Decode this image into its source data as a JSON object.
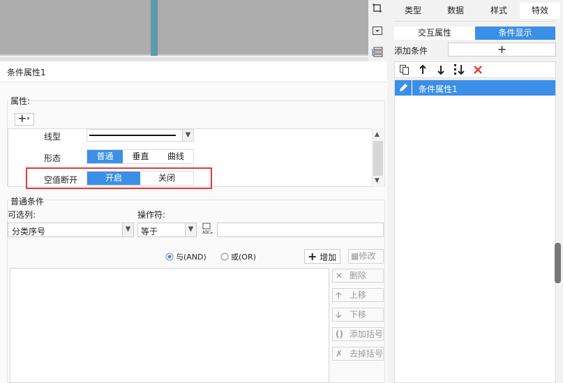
{
  "preview": {},
  "dialog": {
    "title": "条件属性1",
    "properties_label": "属性:",
    "add_symbol": "+",
    "dropdown_symbol": "▾",
    "rows": [
      {
        "label": "线型"
      },
      {
        "label": "形态",
        "options": [
          "普通",
          "垂直",
          "曲线"
        ],
        "selected": "普通"
      },
      {
        "label": "空值断开",
        "options": [
          "开启",
          "关闭"
        ],
        "selected": "开启"
      }
    ],
    "common_label": "普通条件",
    "column_label": "可选列:",
    "column_value": "分类序号",
    "operator_label": "操作符:",
    "operator_value": "等于",
    "value_input": "",
    "and_label": "与(AND)",
    "or_label": "或(OR)",
    "add_label": "增加",
    "modify_label": "修改",
    "delete_label": "删除",
    "up_label": "上移",
    "down_label": "下移",
    "add_bracket_label": "添加括号",
    "remove_bracket_label": "去掉括号"
  },
  "right_panel": {
    "tabs": [
      "类型",
      "数据",
      "样式",
      "特效"
    ],
    "active_tab": "特效",
    "subtabs": [
      "交互属性",
      "条件显示"
    ],
    "active_subtab": "条件显示",
    "add_condition_label": "添加条件",
    "add_symbol": "+",
    "conditions": [
      "条件属性1"
    ]
  },
  "colors": {
    "accent": "#3b8fe6",
    "highlight": "#e53935",
    "delete": "#e53935"
  }
}
